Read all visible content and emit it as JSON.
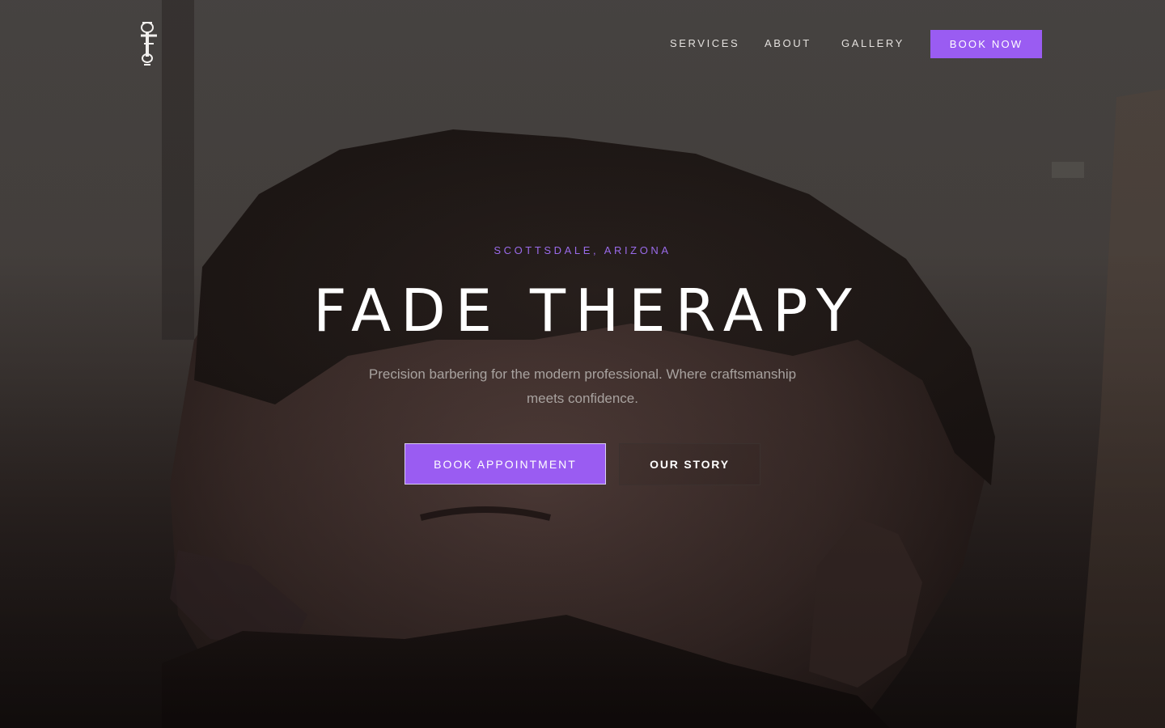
{
  "brand": {
    "logo_icon": "monogram-f-logo",
    "accent_color": "#9a5cf2"
  },
  "nav": {
    "links": [
      {
        "label": "SERVICES"
      },
      {
        "label": "ABOUT"
      },
      {
        "label": "GALLERY"
      }
    ],
    "cta_label": "BOOK NOW"
  },
  "hero": {
    "location": "SCOTTSDALE, ARIZONA",
    "title": "FADE THERAPY",
    "subtitle": "Precision barbering for the modern professional. Where craftsmanship meets confidence.",
    "primary_button": "BOOK APPOINTMENT",
    "secondary_button": "OUR STORY",
    "background_image": "barber-client-portrait"
  }
}
